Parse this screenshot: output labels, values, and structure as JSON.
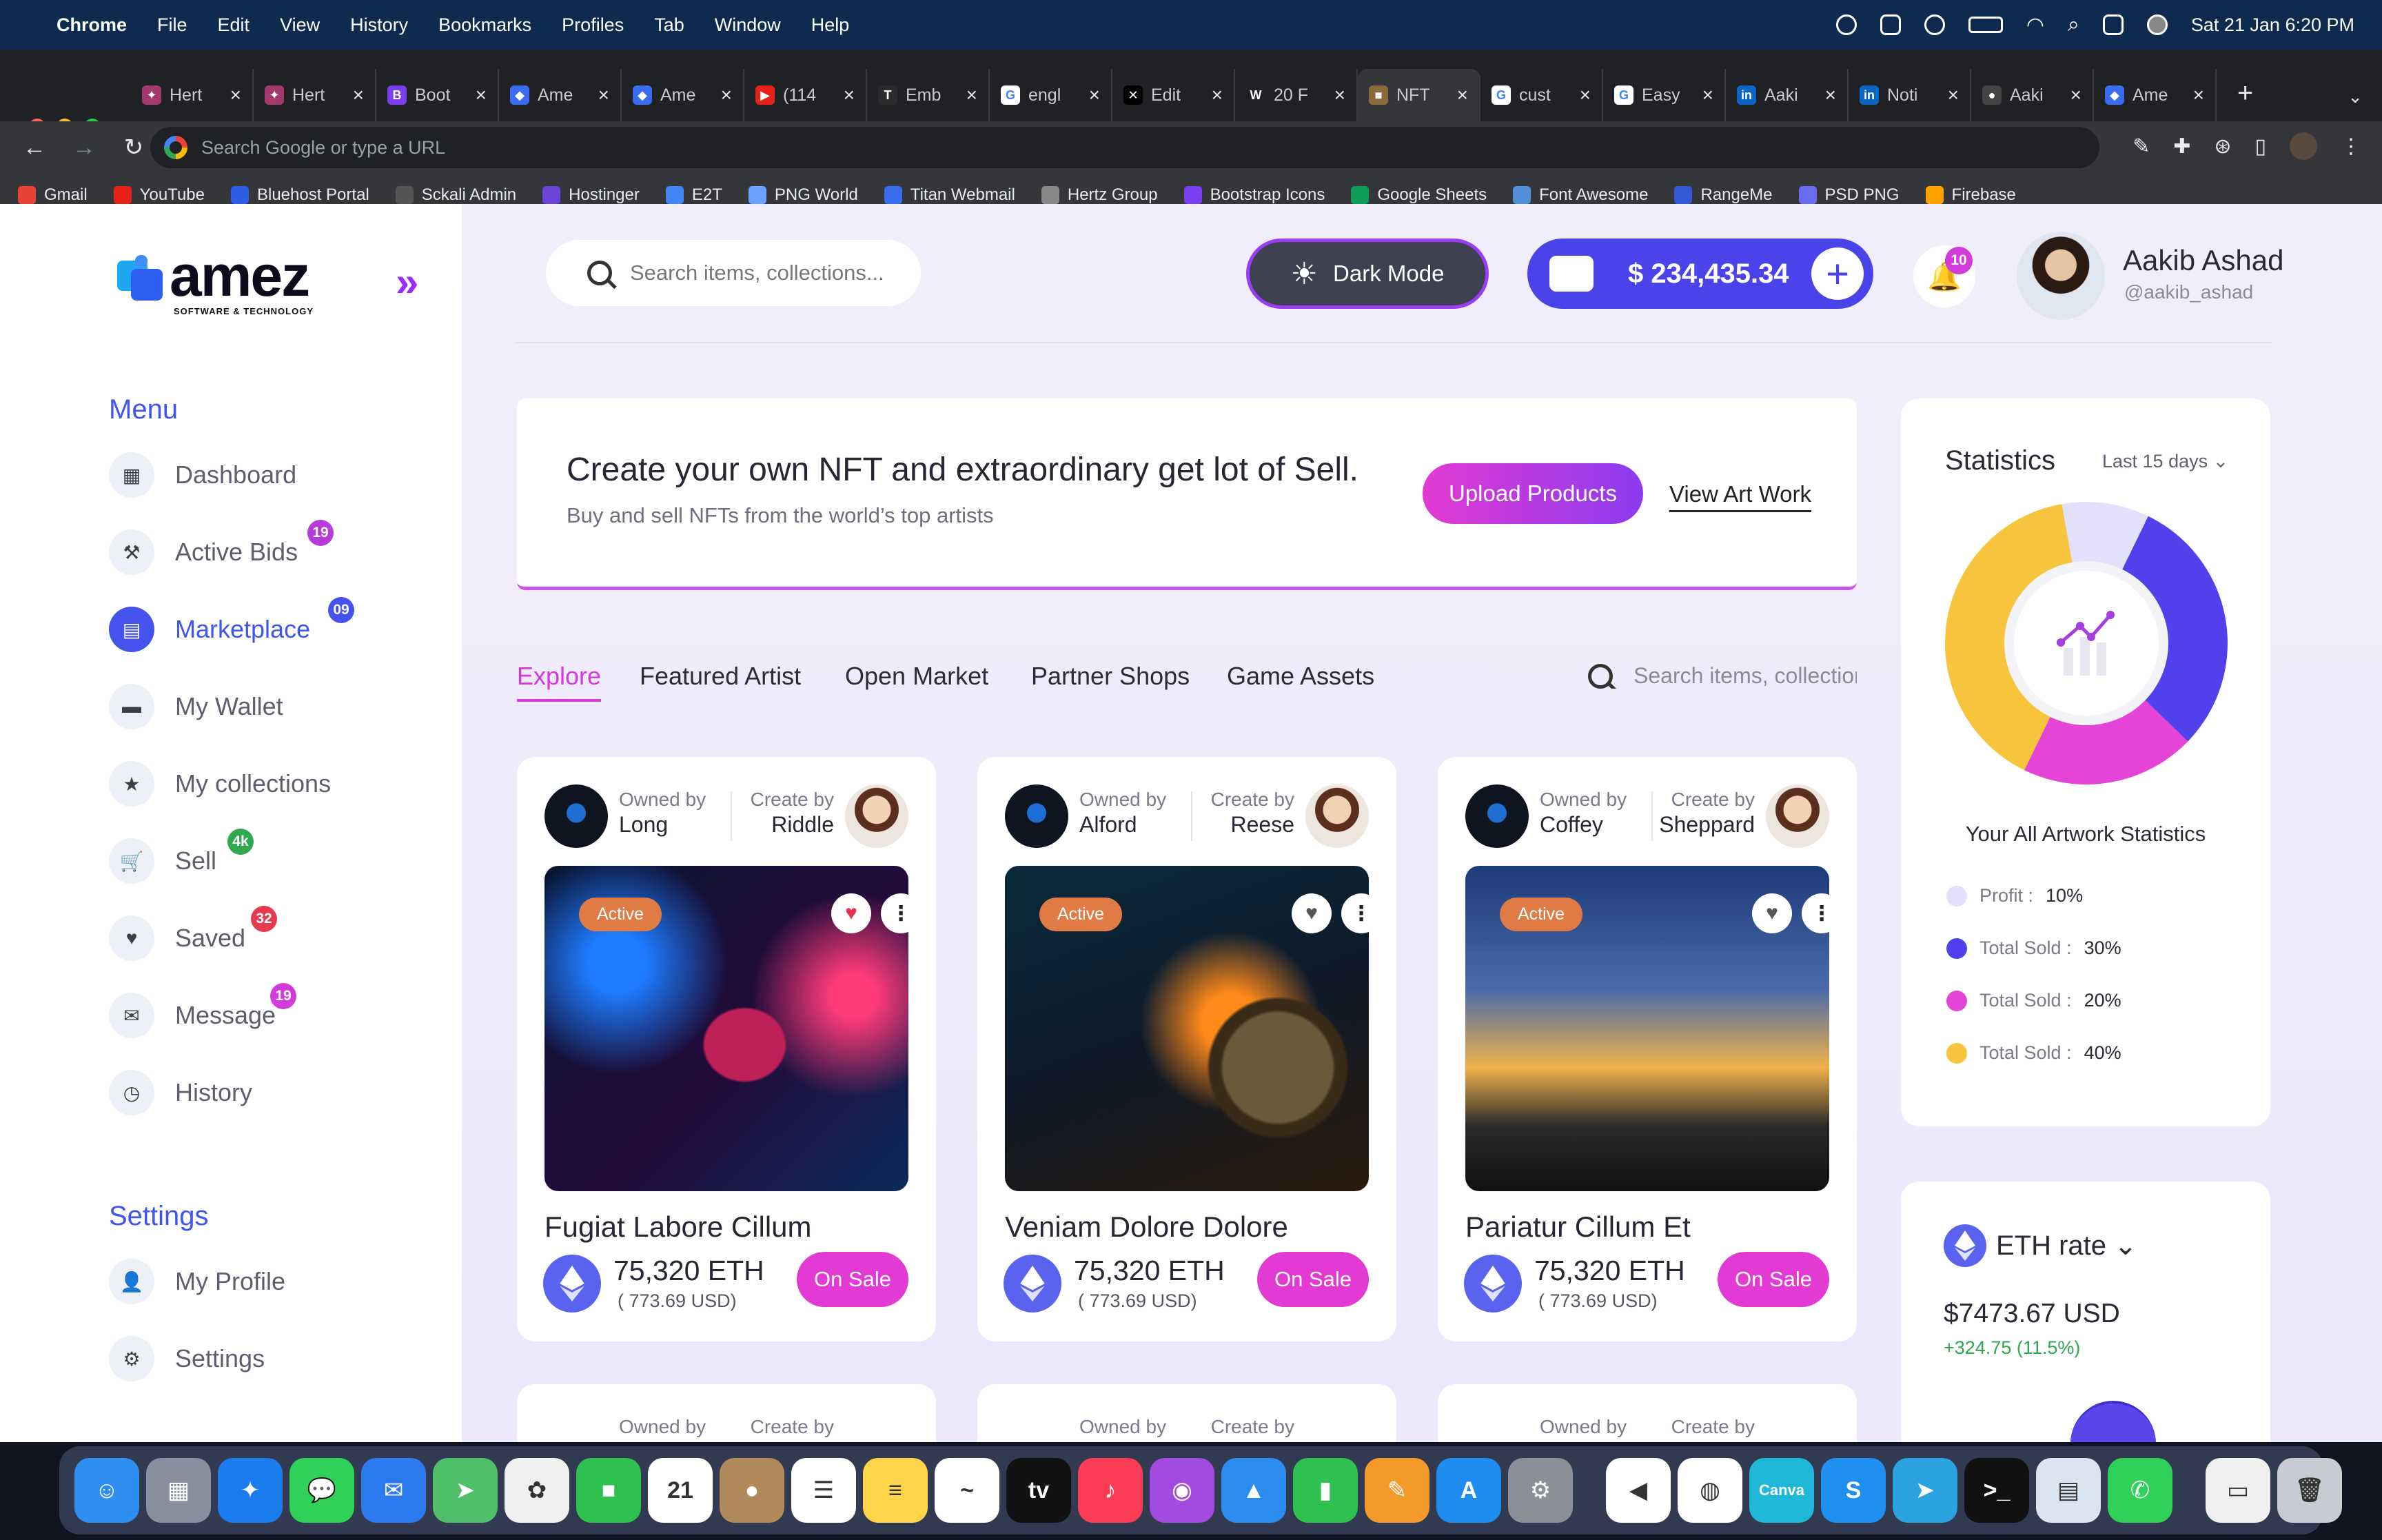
{
  "menubar": {
    "app": "Chrome",
    "menus": [
      "File",
      "Edit",
      "View",
      "History",
      "Bookmarks",
      "Profiles",
      "Tab",
      "Window",
      "Help"
    ],
    "datetime": "Sat 21 Jan  6:20 PM"
  },
  "tabs": [
    {
      "title": "Hert",
      "color": "#a3396f",
      "glyph": "✦"
    },
    {
      "title": "Hert",
      "color": "#a3396f",
      "glyph": "✦"
    },
    {
      "title": "Boot",
      "color": "#7a3df0",
      "glyph": "B"
    },
    {
      "title": "Ame",
      "color": "#3a6cf0",
      "glyph": "◆"
    },
    {
      "title": "Ame",
      "color": "#3a6cf0",
      "glyph": "◆"
    },
    {
      "title": "(114",
      "color": "#e62117",
      "glyph": "▶"
    },
    {
      "title": "Emb",
      "color": "#2b2b2b",
      "glyph": "T"
    },
    {
      "title": "engl",
      "color": "#ffffff",
      "glyph": "G"
    },
    {
      "title": "Edit",
      "color": "#000000",
      "glyph": "✕"
    },
    {
      "title": "20 F",
      "color": "#202124",
      "glyph": "W"
    },
    {
      "title": "NFT",
      "color": "#8a6a3a",
      "glyph": "■"
    },
    {
      "title": "cust",
      "color": "#ffffff",
      "glyph": "G"
    },
    {
      "title": "Easy",
      "color": "#ffffff",
      "glyph": "G"
    },
    {
      "title": "Aaki",
      "color": "#0a66c2",
      "glyph": "in"
    },
    {
      "title": "Noti",
      "color": "#0a66c2",
      "glyph": "in"
    },
    {
      "title": "Aaki",
      "color": "#444",
      "glyph": "●"
    },
    {
      "title": "Ame",
      "color": "#3a6cf0",
      "glyph": "◆"
    }
  ],
  "omnibox": {
    "placeholder": "Search Google or type a URL"
  },
  "bookmarks": [
    {
      "label": "Gmail",
      "color": "#ea4335"
    },
    {
      "label": "YouTube",
      "color": "#e62117"
    },
    {
      "label": "Bluehost Portal",
      "color": "#2c5ee6"
    },
    {
      "label": "Sckali Admin",
      "color": "#555"
    },
    {
      "label": "Hostinger",
      "color": "#6a43d9"
    },
    {
      "label": "E2T",
      "color": "#4285f4"
    },
    {
      "label": "PNG World",
      "color": "#6aa0ff"
    },
    {
      "label": "Titan Webmail",
      "color": "#3a6cf0"
    },
    {
      "label": "Hertz Group",
      "color": "#888"
    },
    {
      "label": "Bootstrap Icons",
      "color": "#7a3df0"
    },
    {
      "label": "Google Sheets",
      "color": "#0f9d58"
    },
    {
      "label": "Font Awesome",
      "color": "#528dd7"
    },
    {
      "label": "RangeMe",
      "color": "#3558d6"
    },
    {
      "label": "PSD PNG",
      "color": "#6a6cf0"
    },
    {
      "label": "Firebase",
      "color": "#ffa000"
    }
  ],
  "logo": {
    "word": "amez",
    "sub": "SOFTWARE & TECHNOLOGY"
  },
  "sidebar": {
    "menu_title": "Menu",
    "items": [
      {
        "label": "Dashboard",
        "icon": "▦"
      },
      {
        "label": "Active Bids",
        "icon": "⚒",
        "badge": "19",
        "badge_color": "#b63cd9"
      },
      {
        "label": "Marketplace",
        "icon": "▤",
        "badge": "09",
        "badge_color": "#4452ee",
        "active": true
      },
      {
        "label": "My Wallet",
        "icon": "▬"
      },
      {
        "label": "My collections",
        "icon": "★"
      },
      {
        "label": "Sell",
        "icon": "🛒",
        "badge": "4k",
        "badge_color": "#2fa84f"
      },
      {
        "label": "Saved",
        "icon": "♥",
        "badge": "32",
        "badge_color": "#e53a4f"
      },
      {
        "label": "Message",
        "icon": "✉",
        "badge": "19",
        "badge_color": "#d33cd8"
      },
      {
        "label": "History",
        "icon": "◷"
      }
    ],
    "settings_title": "Settings",
    "settings_items": [
      {
        "label": "My Profile",
        "icon": "👤"
      },
      {
        "label": "Settings",
        "icon": "⚙"
      }
    ]
  },
  "header": {
    "search_placeholder": "Search items, collections...",
    "dark_mode": "Dark Mode",
    "balance": "$ 234,435.34",
    "notifications": "10",
    "user_name": "Aakib Ashad",
    "user_handle": "@aakib_ashad"
  },
  "banner": {
    "title": "Create your own NFT and extraordinary get lot of Sell.",
    "subtitle": "Buy and sell NFTs from the world’s top artists",
    "upload": "Upload Products",
    "view": "View Art Work"
  },
  "market_tabs": [
    "Explore",
    "Featured Artist",
    "Open Market",
    "Partner Shops",
    "Game Assets"
  ],
  "market_search": "Search items, collections",
  "cards": [
    {
      "owner": "Long",
      "creator": "Riddle",
      "title": "Fugiat Labore Cillum",
      "price": "75,320 ETH",
      "usd": "( 773.69 USD)",
      "status": "Active",
      "sale": "On Sale",
      "liked": true
    },
    {
      "owner": "Alford",
      "creator": "Reese",
      "title": "Veniam Dolore Dolore",
      "price": "75,320 ETH",
      "usd": "( 773.69 USD)",
      "status": "Active",
      "sale": "On Sale",
      "liked": false
    },
    {
      "owner": "Coffey",
      "creator": "Sheppard",
      "title": "Pariatur Cillum Et",
      "price": "75,320 ETH",
      "usd": "( 773.69 USD)",
      "status": "Active",
      "sale": "On Sale",
      "liked": false
    }
  ],
  "card_labels": {
    "owned_by": "Owned by",
    "create_by": "Create by"
  },
  "statistics": {
    "title": "Statistics",
    "range": "Last 15 days",
    "caption": "Your All Artwork Statistics",
    "legend": [
      {
        "label": "Profit :",
        "value": "10%",
        "color": "#e2e0fb"
      },
      {
        "label": "Total Sold :",
        "value": "30%",
        "color": "#5041ec"
      },
      {
        "label": "Total Sold :",
        "value": "20%",
        "color": "#e545d7"
      },
      {
        "label": "Total Sold :",
        "value": "40%",
        "color": "#f7c53d"
      }
    ]
  },
  "eth_rate": {
    "title": "ETH rate",
    "value": "$7473.67 USD",
    "change": "+324.75 (11.5%)"
  },
  "dock": [
    {
      "name": "finder",
      "color": "#2f8ff0",
      "glyph": "☺"
    },
    {
      "name": "launchpad",
      "color": "#8a8fa0",
      "glyph": "▦"
    },
    {
      "name": "safari",
      "color": "#1b7cf0",
      "glyph": "✦"
    },
    {
      "name": "messages",
      "color": "#2fd158",
      "glyph": "💬"
    },
    {
      "name": "mail",
      "color": "#2b7af0",
      "glyph": "✉"
    },
    {
      "name": "maps",
      "color": "#4fbf6a",
      "glyph": "➤"
    },
    {
      "name": "photos",
      "color": "#f0f0f0",
      "glyph": "✿"
    },
    {
      "name": "facetime",
      "color": "#2fc14f",
      "glyph": "■"
    },
    {
      "name": "calendar",
      "color": "#ffffff",
      "glyph": "21"
    },
    {
      "name": "contacts",
      "color": "#b08a5a",
      "glyph": "●"
    },
    {
      "name": "reminders",
      "color": "#ffffff",
      "glyph": "☰"
    },
    {
      "name": "notes",
      "color": "#ffd54a",
      "glyph": "≡"
    },
    {
      "name": "freeform",
      "color": "#ffffff",
      "glyph": "~"
    },
    {
      "name": "tv",
      "color": "#111111",
      "glyph": "tv"
    },
    {
      "name": "music",
      "color": "#fa3c55",
      "glyph": "♪"
    },
    {
      "name": "podcasts",
      "color": "#a24be0",
      "glyph": "◉"
    },
    {
      "name": "keynote",
      "color": "#2c8cf0",
      "glyph": "▲"
    },
    {
      "name": "numbers",
      "color": "#2fc14f",
      "glyph": "▮"
    },
    {
      "name": "pages",
      "color": "#f39a2b",
      "glyph": "✎"
    },
    {
      "name": "app-store",
      "color": "#1f8df0",
      "glyph": "A"
    },
    {
      "name": "system-settings",
      "color": "#8a8f98",
      "glyph": "⚙"
    },
    {
      "name": "vscode",
      "color": "#ffffff",
      "glyph": "◀"
    },
    {
      "name": "chrome",
      "color": "#ffffff",
      "glyph": "◍"
    },
    {
      "name": "canva",
      "color": "#1fb8d8",
      "glyph": "Canva"
    },
    {
      "name": "skype",
      "color": "#1f8ff0",
      "glyph": "S"
    },
    {
      "name": "telegram",
      "color": "#2aa3e0",
      "glyph": "➤"
    },
    {
      "name": "terminal",
      "color": "#111111",
      "glyph": ">_"
    },
    {
      "name": "preview",
      "color": "#d9e6f2",
      "glyph": "▤"
    },
    {
      "name": "whatsapp",
      "color": "#2fd158",
      "glyph": "✆"
    },
    {
      "name": "downloads",
      "color": "#f0f0f0",
      "glyph": "▭"
    },
    {
      "name": "trash",
      "color": "#c8ccd2",
      "glyph": "🗑"
    }
  ]
}
